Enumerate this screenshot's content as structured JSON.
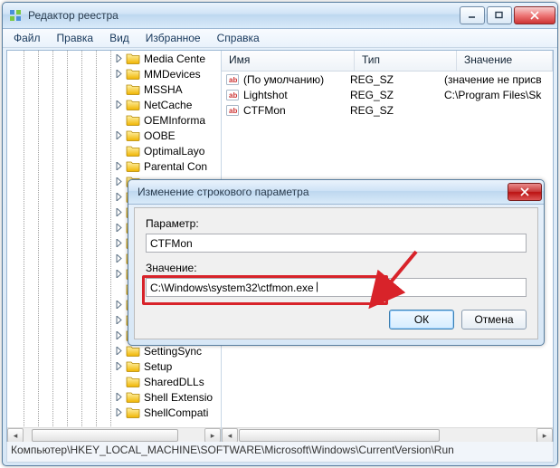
{
  "window": {
    "title": "Редактор реестра",
    "menus": [
      "Файл",
      "Правка",
      "Вид",
      "Избранное",
      "Справка"
    ]
  },
  "tree": {
    "items": [
      {
        "label": "Media Cente",
        "expandable": true
      },
      {
        "label": "MMDevices",
        "expandable": true
      },
      {
        "label": "MSSHA",
        "expandable": false
      },
      {
        "label": "NetCache",
        "expandable": true
      },
      {
        "label": "OEMInforma",
        "expandable": false
      },
      {
        "label": "OOBE",
        "expandable": true
      },
      {
        "label": "OptimalLayo",
        "expandable": false
      },
      {
        "label": "Parental Con",
        "expandable": true
      },
      {
        "label": "",
        "expandable": true
      },
      {
        "label": "",
        "expandable": true
      },
      {
        "label": "",
        "expandable": true
      },
      {
        "label": "",
        "expandable": true
      },
      {
        "label": "",
        "expandable": true
      },
      {
        "label": "",
        "expandable": true
      },
      {
        "label": "",
        "expandable": true
      },
      {
        "label": "",
        "expandable": false
      },
      {
        "label": "",
        "expandable": true
      },
      {
        "label": "",
        "expandable": true
      },
      {
        "label": "",
        "expandable": true
      },
      {
        "label": "SettingSync",
        "expandable": true
      },
      {
        "label": "Setup",
        "expandable": true
      },
      {
        "label": "SharedDLLs",
        "expandable": false
      },
      {
        "label": "Shell Extensio",
        "expandable": true
      },
      {
        "label": "ShellCompati",
        "expandable": true
      }
    ]
  },
  "list": {
    "columns": {
      "name": "Имя",
      "type": "Тип",
      "value": "Значение"
    },
    "rows": [
      {
        "name": "(По умолчанию)",
        "type": "REG_SZ",
        "value": "(значение не присв"
      },
      {
        "name": "Lightshot",
        "type": "REG_SZ",
        "value": "C:\\Program Files\\Sk"
      },
      {
        "name": "CTFMon",
        "type": "REG_SZ",
        "value": ""
      }
    ]
  },
  "dialog": {
    "title": "Изменение строкового параметра",
    "param_label": "Параметр:",
    "param_value": "CTFMon",
    "value_label": "Значение:",
    "value_value": "C:\\Windows\\system32\\ctfmon.exe",
    "ok": "ОК",
    "cancel": "Отмена"
  },
  "statusbar": "Компьютер\\HKEY_LOCAL_MACHINE\\SOFTWARE\\Microsoft\\Windows\\CurrentVersion\\Run"
}
